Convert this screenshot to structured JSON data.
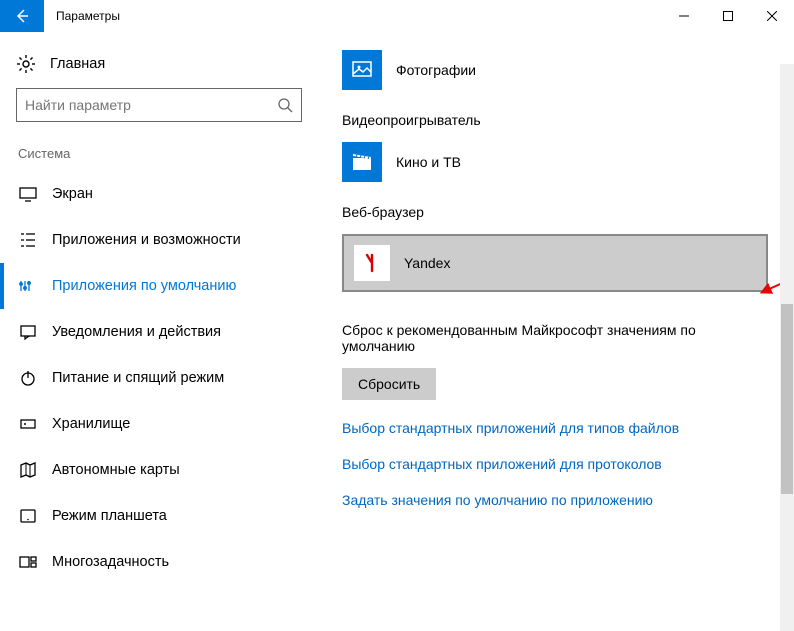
{
  "titlebar": {
    "title": "Параметры"
  },
  "sidebar": {
    "home": "Главная",
    "search_placeholder": "Найти параметр",
    "section": "Система",
    "items": [
      {
        "label": "Экран",
        "icon": "display"
      },
      {
        "label": "Приложения и возможности",
        "icon": "apps"
      },
      {
        "label": "Приложения по умолчанию",
        "icon": "defaults",
        "active": true
      },
      {
        "label": "Уведомления и действия",
        "icon": "notify"
      },
      {
        "label": "Питание и спящий режим",
        "icon": "power"
      },
      {
        "label": "Хранилище",
        "icon": "storage"
      },
      {
        "label": "Автономные карты",
        "icon": "maps"
      },
      {
        "label": "Режим планшета",
        "icon": "tablet"
      },
      {
        "label": "Многозадачность",
        "icon": "multitask"
      }
    ]
  },
  "content": {
    "photos": {
      "label": "Фотографии"
    },
    "video": {
      "heading": "Видеопроигрыватель",
      "label": "Кино и ТВ"
    },
    "browser": {
      "heading": "Веб-браузер",
      "label": "Yandex"
    },
    "reset": {
      "desc": "Сброс к рекомендованным Майкрософт значениям по умолчанию",
      "button": "Сбросить"
    },
    "links": [
      "Выбор стандартных приложений для типов файлов",
      "Выбор стандартных приложений для протоколов",
      "Задать значения по умолчанию по приложению"
    ]
  }
}
